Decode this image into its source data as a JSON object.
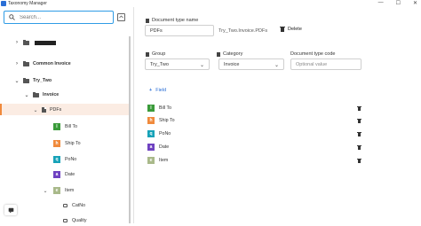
{
  "window": {
    "title": "Taxonomy Manager",
    "minimize": "—",
    "maximize": "☐",
    "close": "✕"
  },
  "search": {
    "placeholder": "Search..."
  },
  "tree": {
    "root_redacted_label": "",
    "common_invoice": "Common Invoice",
    "try_two": "Try_Two",
    "invoice": "Invoice",
    "pdfs": "PDFs",
    "fields": [
      {
        "badge": "I",
        "color": "#3a9b3a",
        "label": "Bill To"
      },
      {
        "badge": "h",
        "color": "#f08a3c",
        "label": "Ship To"
      },
      {
        "badge": "q",
        "color": "#17a2b8",
        "label": "PoNo"
      },
      {
        "badge": "a",
        "color": "#6f42c1",
        "label": "Date"
      },
      {
        "badge": "e",
        "color": "#a9b98a",
        "label": "Item"
      }
    ],
    "item_children": [
      "CatNo",
      "Quality"
    ]
  },
  "form": {
    "doc_type_name_label": "Document type name",
    "doc_type_name_value": "PDFs",
    "path_text": "Try_Two.Invoice.PDFs",
    "delete_label": "Delete",
    "group_label": "Group",
    "group_value": "Try_Two",
    "category_label": "Category",
    "category_value": "Invoice",
    "doc_type_code_label": "Document type code",
    "doc_type_code_placeholder": "Optional value",
    "add_field_label": "Field",
    "fields": [
      {
        "badge": "I",
        "color": "#3a9b3a",
        "label": "Bill To"
      },
      {
        "badge": "h",
        "color": "#f08a3c",
        "label": "Ship To"
      },
      {
        "badge": "q",
        "color": "#17a2b8",
        "label": "PoNo"
      },
      {
        "badge": "a",
        "color": "#6f42c1",
        "label": "Date"
      },
      {
        "badge": "e",
        "color": "#a9b98a",
        "label": "Item"
      }
    ]
  },
  "colors": {
    "accent": "#2f9ce5",
    "selection": "#fbece3",
    "selection_border": "#f08a3c"
  }
}
